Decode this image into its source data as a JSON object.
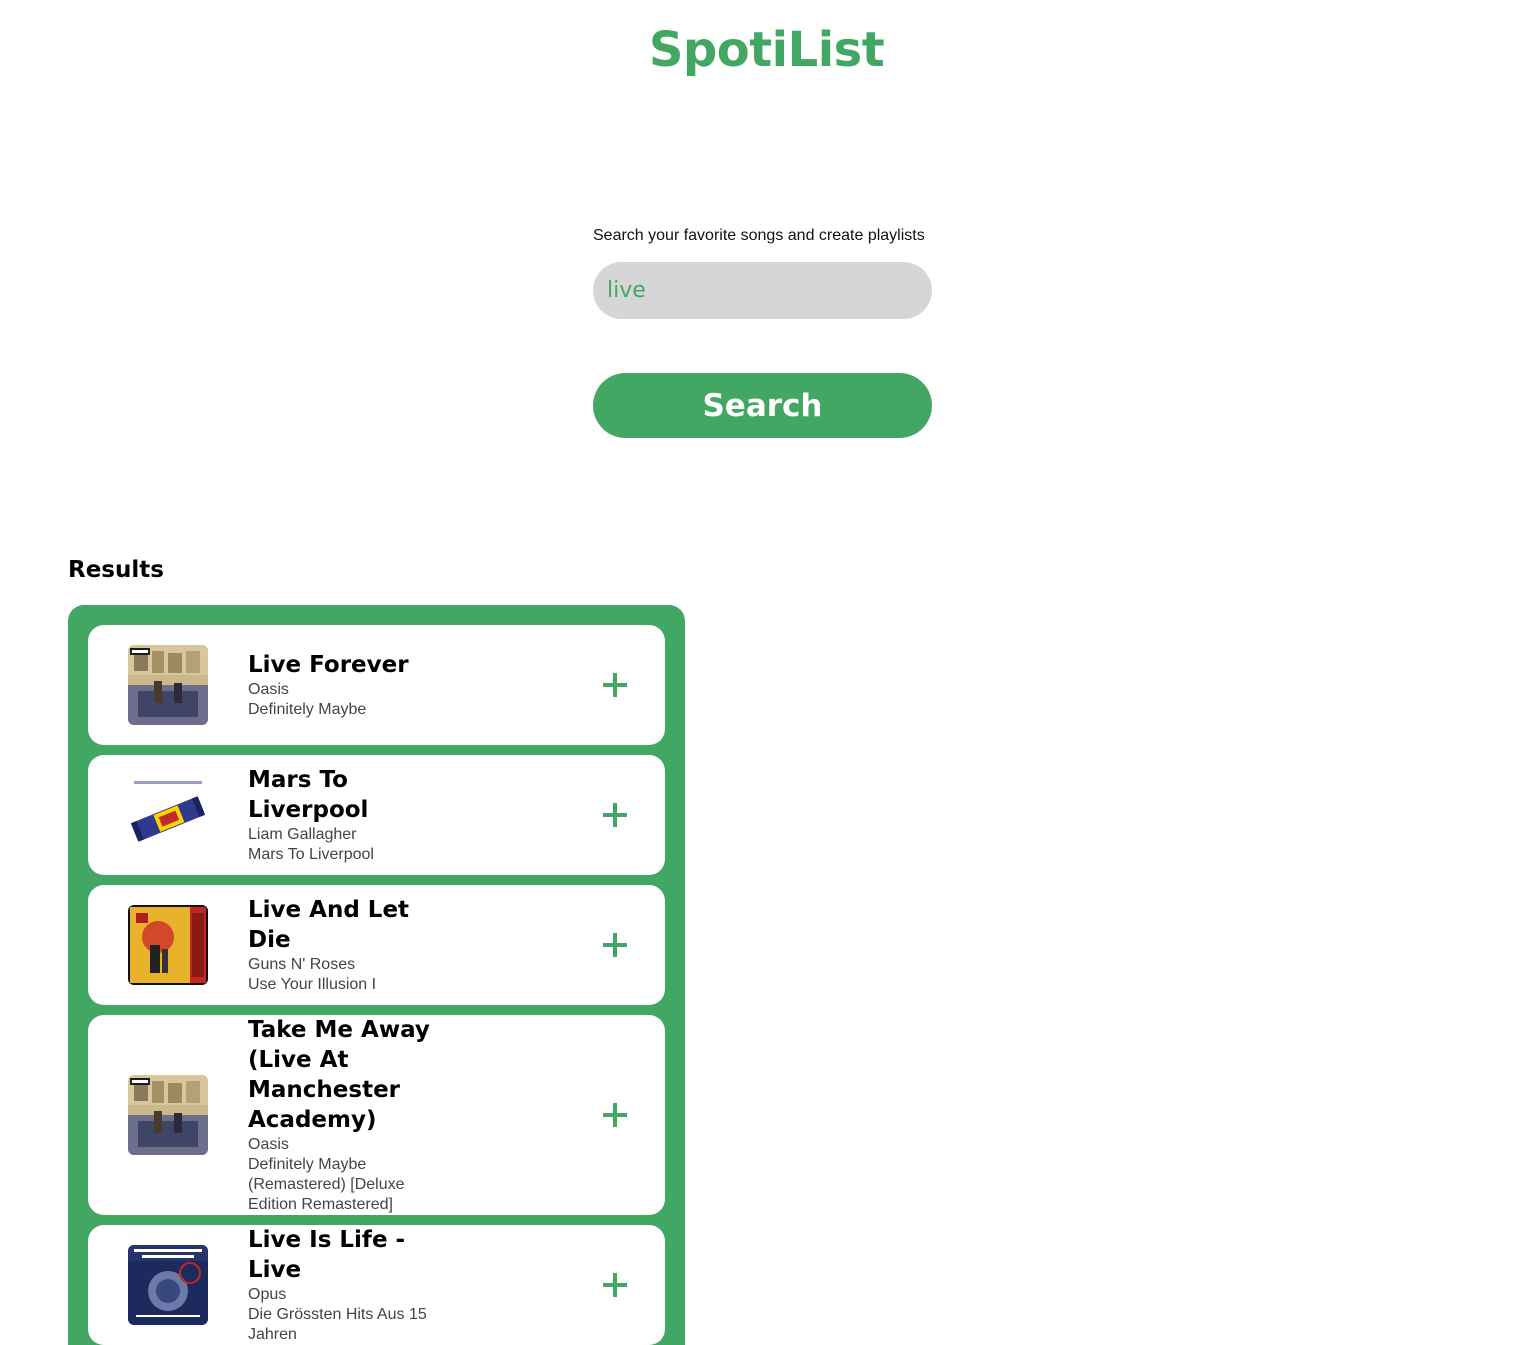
{
  "app": {
    "title": "SpotiList",
    "accent_color": "#41a763"
  },
  "search": {
    "prompt": "Search your favorite songs and create playlists",
    "value": "live",
    "button_label": "Search"
  },
  "results": {
    "heading": "Results",
    "items": [
      {
        "title": "Live Forever",
        "artist": "Oasis",
        "album": "Definitely Maybe",
        "cover_icon": "album-cover-oasis"
      },
      {
        "title": "Mars To Liverpool",
        "artist": "Liam Gallagher",
        "album": "Mars To Liverpool",
        "cover_icon": "album-cover-candy-bar"
      },
      {
        "title": "Live And Let Die",
        "artist": "Guns N' Roses",
        "album": "Use Your Illusion I",
        "cover_icon": "album-cover-illusion"
      },
      {
        "title": "Take Me Away (Live At Manchester Academy)",
        "artist": "Oasis",
        "album": "Definitely Maybe (Remastered) [Deluxe Edition Remastered]",
        "cover_icon": "album-cover-oasis"
      },
      {
        "title": "Live Is Life - Live",
        "artist": "Opus",
        "album": "Die Grössten Hits Aus 15 Jahren",
        "cover_icon": "album-cover-opus"
      }
    ],
    "add_icon": "plus-icon"
  }
}
